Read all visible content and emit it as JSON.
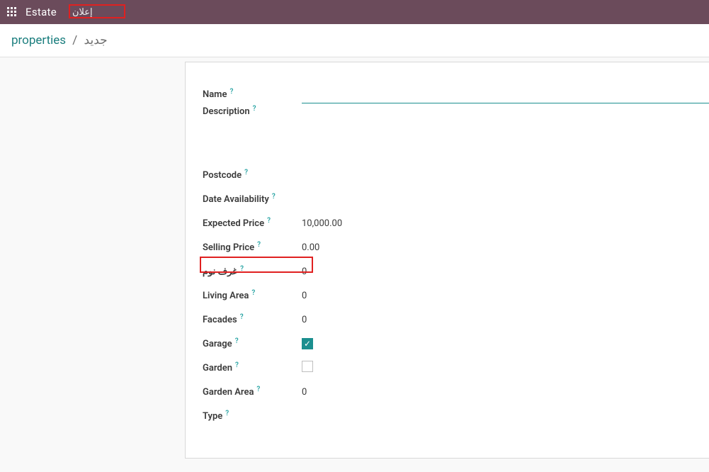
{
  "topbar": {
    "brand": "Estate",
    "menu_item": "إعلان"
  },
  "breadcrumb": {
    "parent": "properties",
    "separator": "/",
    "current": "جديد"
  },
  "tooltip_symbol": "?",
  "form": {
    "name": {
      "label": "Name",
      "value": ""
    },
    "description": {
      "label": "Description",
      "value": ""
    },
    "postcode": {
      "label": "Postcode",
      "value": ""
    },
    "date_avail": {
      "label": "Date Availability",
      "value": ""
    },
    "expected_price": {
      "label": "Expected Price",
      "value": "10,000.00"
    },
    "selling_price": {
      "label": "Selling Price",
      "value": "0.00"
    },
    "bedrooms": {
      "label": "غرف نوم",
      "value": "0"
    },
    "living_area": {
      "label": "Living Area",
      "value": "0"
    },
    "facades": {
      "label": "Facades",
      "value": "0"
    },
    "garage": {
      "label": "Garage",
      "checked": true,
      "glyph": "✓"
    },
    "garden": {
      "label": "Garden",
      "checked": false
    },
    "garden_area": {
      "label": "Garden Area",
      "value": "0"
    },
    "type": {
      "label": "Type",
      "value": ""
    }
  }
}
